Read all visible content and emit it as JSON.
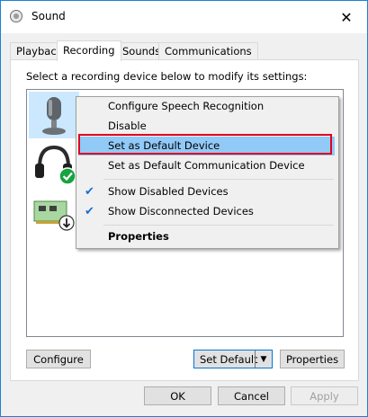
{
  "window": {
    "title": "Sound",
    "close_glyph": "✕"
  },
  "tabs": [
    {
      "label": "Playback"
    },
    {
      "label": "Recording"
    },
    {
      "label": "Sounds"
    },
    {
      "label": "Communications"
    }
  ],
  "recording": {
    "instruction": "Select a recording device below to modify its settings:",
    "devices": [
      {
        "icon": "microphone-icon"
      },
      {
        "icon": "headset-icon",
        "badge": "default-check-icon"
      },
      {
        "icon": "circuit-board-icon",
        "badge": "arrow-down-icon"
      }
    ],
    "buttons": {
      "configure": "Configure",
      "set_default": "Set Default",
      "properties": "Properties"
    }
  },
  "context_menu": {
    "items": [
      {
        "label": "Configure Speech Recognition"
      },
      {
        "label": "Disable"
      },
      {
        "label": "Set as Default Device"
      },
      {
        "label": "Set as Default Communication Device"
      },
      {
        "label": "Show Disabled Devices",
        "checked": true
      },
      {
        "label": "Show Disconnected Devices",
        "checked": true
      },
      {
        "label": "Properties"
      }
    ]
  },
  "dialog_buttons": {
    "ok": "OK",
    "cancel": "Cancel",
    "apply": "Apply"
  },
  "colors": {
    "highlight": "#91c9f7",
    "callout_red": "#e2001a",
    "check_blue": "#1a6fd1",
    "accent": "#0078d7"
  }
}
